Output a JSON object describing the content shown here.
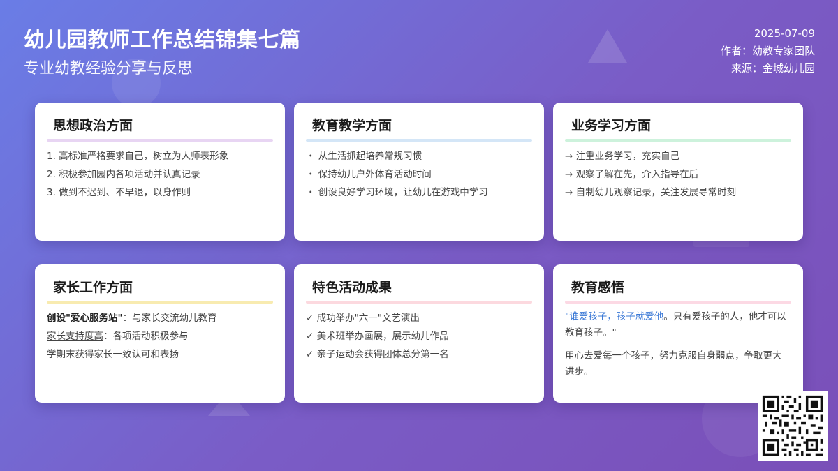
{
  "header": {
    "title": "幼儿园教师工作总结锦集七篇",
    "subtitle": "专业幼教经验分享与反思"
  },
  "meta": {
    "date": "2025-07-09",
    "author": "作者：幼教专家团队",
    "source": "来源：金城幼儿园"
  },
  "cards": [
    {
      "title": "思想政治方面",
      "accent": "#e8d5f3",
      "items": [
        "1. 高标准严格要求自己，树立为人师表形象",
        "2. 积极参加园内各项活动并认真记录",
        "3. 做到不迟到、不早退，以身作则"
      ]
    },
    {
      "title": "教育教学方面",
      "accent": "#d4e6f7",
      "items": [
        "・ 从生活抓起培养常规习惯",
        "・ 保持幼儿户外体育活动时间",
        "・ 创设良好学习环境，让幼儿在游戏中学习"
      ]
    },
    {
      "title": "业务学习方面",
      "accent": "#cdf2dc",
      "items": [
        "→ 注重业务学习，充实自己",
        "→ 观察了解在先，介入指导在后",
        "→ 自制幼儿观察记录，关注发展寻常时刻"
      ]
    },
    {
      "title": "家长工作方面",
      "accent": "#f8ebb0",
      "line1_bold": "创设\"爱心服务站\"",
      "line1_rest": "：与家长交流幼儿教育",
      "line2_underline": "家长支持度高",
      "line2_rest": "：各项活动积极参与",
      "line3": "学期末获得家长一致认可和表扬"
    },
    {
      "title": "特色活动成果",
      "accent": "#fcd9df",
      "items": [
        "✓ 成功举办\"六一\"文艺演出",
        "✓ 美术班举办画展，展示幼儿作品",
        "✓ 亲子运动会获得团体总分第一名"
      ]
    },
    {
      "title": "教育感悟",
      "accent": "#fcd9e4",
      "quote_open": "\"",
      "quote_highlight": "谁爱孩子，孩子就爱他",
      "quote_rest": "。只有爱孩子的人，他才可以教育孩子。\"",
      "paragraph": "用心去爱每一个孩子，努力克服自身弱点，争取更大进步。"
    }
  ]
}
